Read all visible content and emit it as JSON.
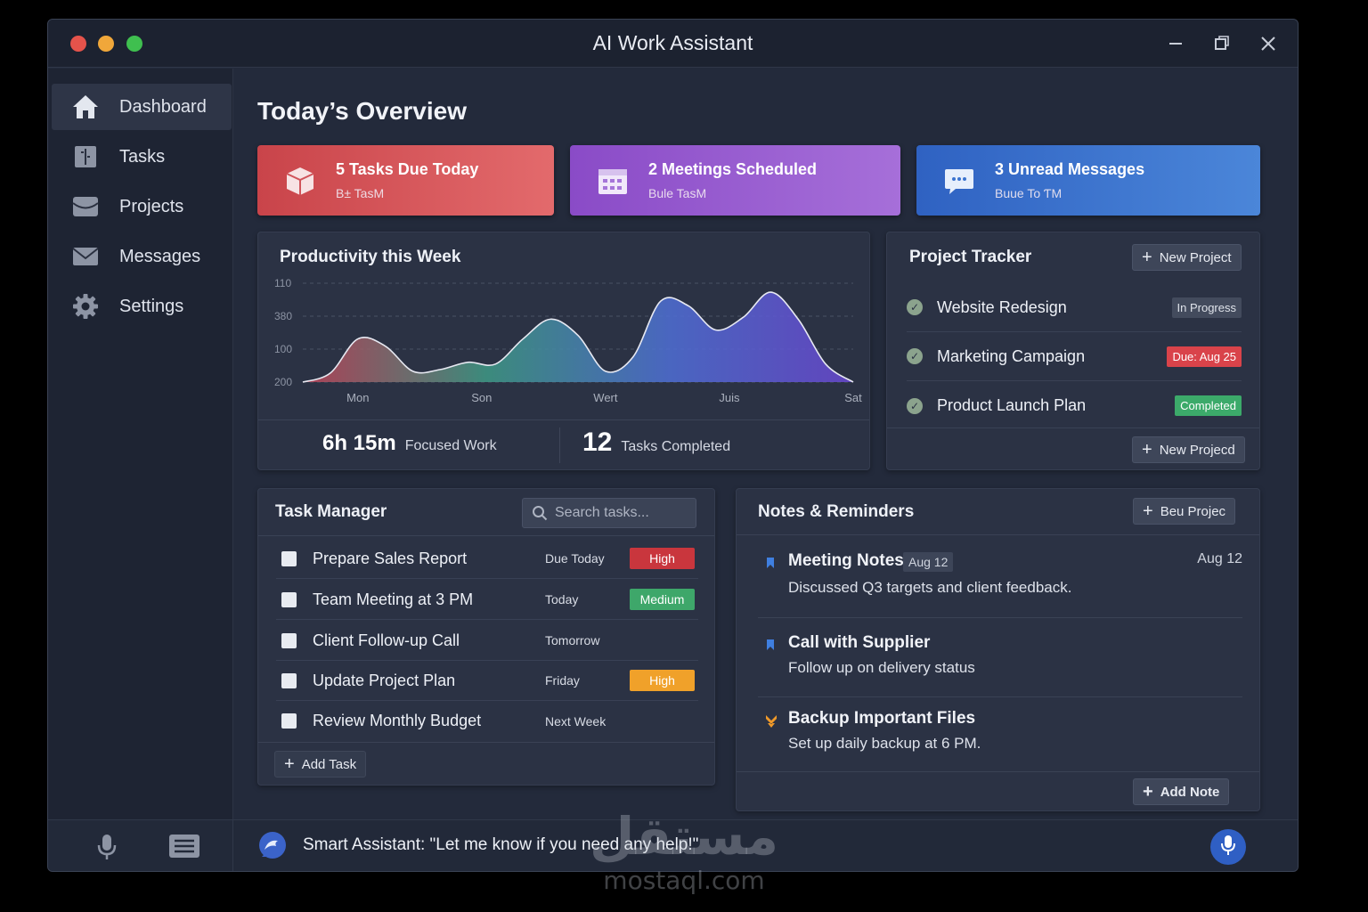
{
  "window": {
    "title": "AI Work Assistant"
  },
  "sidebar": {
    "items": [
      {
        "label": "Dashboard",
        "icon": "home-icon",
        "active": true
      },
      {
        "label": "Tasks",
        "icon": "tasks-icon"
      },
      {
        "label": "Projects",
        "icon": "folder-icon"
      },
      {
        "label": "Messages",
        "icon": "mail-icon"
      },
      {
        "label": "Settings",
        "icon": "gear-icon"
      }
    ]
  },
  "main": {
    "title": "Today’s Overview",
    "cards": [
      {
        "title": "5 Tasks Due Today",
        "subtitle": "B± TasM",
        "icon": "box-icon",
        "color": "#d9545a"
      },
      {
        "title": "2 Meetings Scheduled",
        "subtitle": "Bule TasM",
        "icon": "calendar-icon",
        "color": "#9a5fd3"
      },
      {
        "title": "3 Unread Messages",
        "subtitle": "Buue To ƬM",
        "icon": "chat-icon",
        "color": "#3c74cf"
      }
    ]
  },
  "productivity": {
    "title": "Productivity this Week",
    "focused_value": "6h 15m",
    "focused_label": "Focused Work",
    "completed_value": "12",
    "completed_label": "Tasks Completed"
  },
  "chart_data": {
    "type": "area",
    "title": "Productivity this Week",
    "y_tick_labels": [
      "110",
      "380",
      "100",
      "200"
    ],
    "x_tick_labels": [
      "Mon",
      "Son",
      "Wert",
      "Juis",
      "Sat"
    ],
    "x": [
      0,
      0.5,
      1,
      1.5,
      2,
      2.5,
      3,
      3.5,
      4,
      4.5,
      5,
      5.5,
      6,
      6.5,
      7,
      7.5,
      8,
      8.5,
      9,
      9.5,
      10
    ],
    "values": [
      0,
      10,
      48,
      40,
      12,
      14,
      22,
      20,
      48,
      70,
      52,
      12,
      28,
      90,
      85,
      58,
      72,
      100,
      70,
      20,
      0
    ],
    "ylim": [
      0,
      110
    ],
    "colors": [
      "#c3445a",
      "#3f9a86",
      "#4f6fd6",
      "#6a48d2"
    ],
    "grid": true
  },
  "tracker": {
    "title": "Project Tracker",
    "new_button_top": "New Project",
    "new_button_bottom": "New Projecd",
    "projects": [
      {
        "name": "Website Redesign",
        "status": "In Progress",
        "status_color": "#434b5d"
      },
      {
        "name": "Marketing Campaign",
        "status": "Due: Aug 25",
        "status_color": "#d9434a"
      },
      {
        "name": "Product Launch Plan",
        "status": "Completed",
        "status_color": "#3caa6a"
      }
    ]
  },
  "task_manager": {
    "title": "Task Manager",
    "search_placeholder": "Search tasks...",
    "add_label": "Add Task",
    "tasks": [
      {
        "name": "Prepare Sales Report",
        "due": "Due Today",
        "priority": "High",
        "priority_color": "#c9363d"
      },
      {
        "name": "Team Meeting at 3 PM",
        "due": "Today",
        "priority": "Medium",
        "priority_color": "#3ea76a"
      },
      {
        "name": "Client Follow-up Call",
        "due": "Tomorrow",
        "priority": ""
      },
      {
        "name": "Update Project Plan",
        "due": "Friday",
        "priority": "High",
        "priority_color": "#f0a12a"
      },
      {
        "name": "Review Monthly Budget",
        "due": "Next Week",
        "priority": ""
      }
    ]
  },
  "notes": {
    "title": "Notes & Reminders",
    "header_button": "Beu Projec",
    "add_label": "Add Note",
    "items": [
      {
        "title": "Meeting Notes",
        "tag": "Aug 12",
        "date": "Aug 12",
        "body": "Discussed Q3 targets and client feedback.",
        "marker_color": "#3f7fe0"
      },
      {
        "title": "Call with Supplier",
        "body": "Follow up on delivery status",
        "marker_color": "#3f7fe0"
      },
      {
        "title": "Backup Important Files",
        "body": "Set up daily backup at 6 PM.",
        "marker_color": "#f09a2a"
      }
    ]
  },
  "assistant": {
    "message": "Smart Assistant: \"Let me know if you need any help!\""
  },
  "watermark": {
    "arabic": "مستقل",
    "latin": "mostaql.com"
  }
}
